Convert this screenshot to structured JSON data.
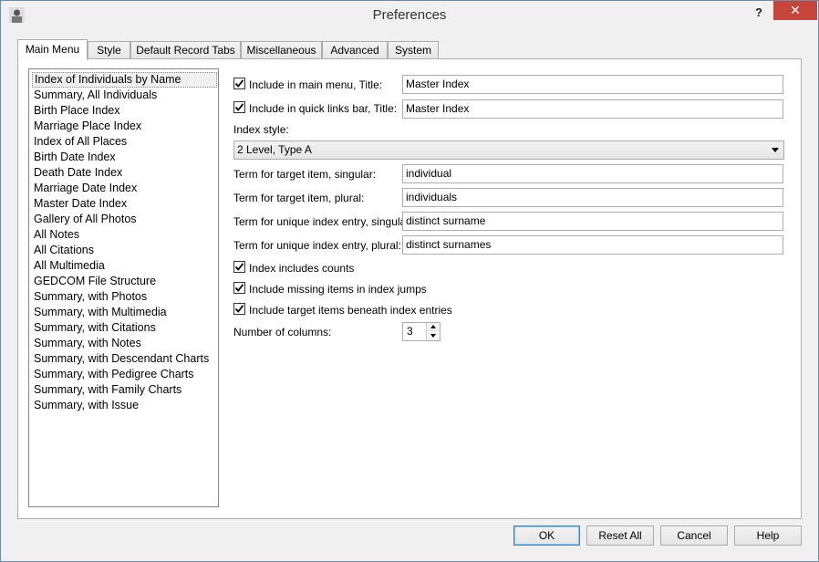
{
  "window": {
    "title": "Preferences",
    "help_label": "?",
    "close_label": "✕"
  },
  "tabs": [
    {
      "label": "Main Menu",
      "active": true
    },
    {
      "label": "Style"
    },
    {
      "label": "Default Record Tabs"
    },
    {
      "label": "Miscellaneous"
    },
    {
      "label": "Advanced"
    },
    {
      "label": "System"
    }
  ],
  "list": {
    "items": [
      "Index of Individuals by Name",
      "Summary, All Individuals",
      "Birth Place Index",
      "Marriage Place Index",
      "Index of All Places",
      "Birth Date Index",
      "Death Date Index",
      "Marriage Date Index",
      "Master Date Index",
      "Gallery of All Photos",
      "All Notes",
      "All Citations",
      "All Multimedia",
      "GEDCOM File Structure",
      "Summary, with Photos",
      "Summary, with Multimedia",
      "Summary, with Citations",
      "Summary, with Notes",
      "Summary, with Descendant Charts",
      "Summary, with Pedigree Charts",
      "Summary, with Family Charts",
      "Summary, with Issue"
    ],
    "selected_index": 0
  },
  "form": {
    "main_menu_label": "Include in main menu, Title:",
    "main_menu_checked": true,
    "main_menu_title": "Master Index",
    "quick_links_label": "Include in quick links bar, Title:",
    "quick_links_checked": true,
    "quick_links_title": "Master Index",
    "index_style_label": "Index style:",
    "index_style_value": "2 Level, Type A",
    "term_singular_label": "Term for target item, singular:",
    "term_singular_value": "individual",
    "term_plural_label": "Term for target item, plural:",
    "term_plural_value": "individuals",
    "unique_singular_label": "Term for unique index entry, singular:",
    "unique_singular_value": "distinct surname",
    "unique_plural_label": "Term for unique index entry, plural:",
    "unique_plural_value": "distinct surnames",
    "counts_label": "Index includes counts",
    "counts_checked": true,
    "missing_label": "Include missing items in index jumps",
    "missing_checked": true,
    "beneath_label": "Include target items beneath index entries",
    "beneath_checked": true,
    "columns_label": "Number of columns:",
    "columns_value": "3"
  },
  "buttons": {
    "ok": "OK",
    "reset_all": "Reset All",
    "cancel": "Cancel",
    "help": "Help"
  }
}
